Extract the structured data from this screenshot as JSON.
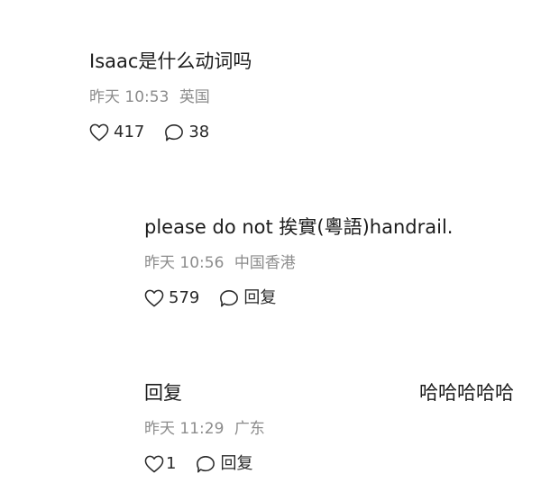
{
  "comments": [
    {
      "text": "Isaac是什么动词吗",
      "time": "昨天 10:53",
      "location": "英国",
      "likes": "417",
      "replies": "38"
    },
    {
      "text": "please do not 挨實(粵語)handrail.",
      "time": "昨天 10:56",
      "location": "中国香港",
      "likes": "579",
      "replies": "回复"
    },
    {
      "text": "回复",
      "text_right": "哈哈哈哈哈",
      "time": "昨天 11:29",
      "location": "广东",
      "likes": "1",
      "replies": "回复"
    }
  ]
}
